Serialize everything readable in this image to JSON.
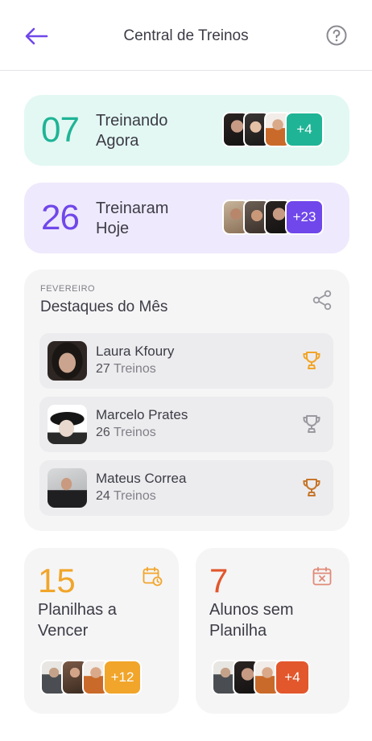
{
  "header": {
    "title": "Central de Treinos",
    "back_icon": "arrow-left-icon",
    "help_icon": "question-circle-icon"
  },
  "colors": {
    "accent_purple": "#7047ea",
    "accent_teal": "#1fb496",
    "accent_orange": "#f1a52a",
    "accent_red": "#e2572c",
    "gold": "#f1a52a",
    "silver": "#9a9aa0",
    "bronze": "#c6762a"
  },
  "training_now": {
    "count": "07",
    "label_line1": "Treinando",
    "label_line2": "Agora",
    "extra": "+4"
  },
  "trained_today": {
    "count": "26",
    "label_line1": "Treinaram",
    "label_line2": "Hoje",
    "extra": "+23"
  },
  "highlights": {
    "month": "FEVEREIRO",
    "title": "Destaques do Mês",
    "share_icon": "share-icon",
    "ranking": [
      {
        "name": "Laura Kfoury",
        "count": "27",
        "unit": "Treinos",
        "trophy": "gold-trophy-icon"
      },
      {
        "name": "Marcelo Prates",
        "count": "26",
        "unit": "Treinos",
        "trophy": "silver-trophy-icon"
      },
      {
        "name": "Mateus Correa",
        "count": "24",
        "unit": "Treinos",
        "trophy": "bronze-trophy-icon"
      }
    ]
  },
  "expiring_plans": {
    "count": "15",
    "label_line1": "Planilhas a",
    "label_line2": "Vencer",
    "extra": "+12",
    "icon": "calendar-clock-icon"
  },
  "students_without_plan": {
    "count": "7",
    "label_line1": "Alunos sem",
    "label_line2": "Planilha",
    "extra": "+4",
    "icon": "calendar-x-icon"
  }
}
